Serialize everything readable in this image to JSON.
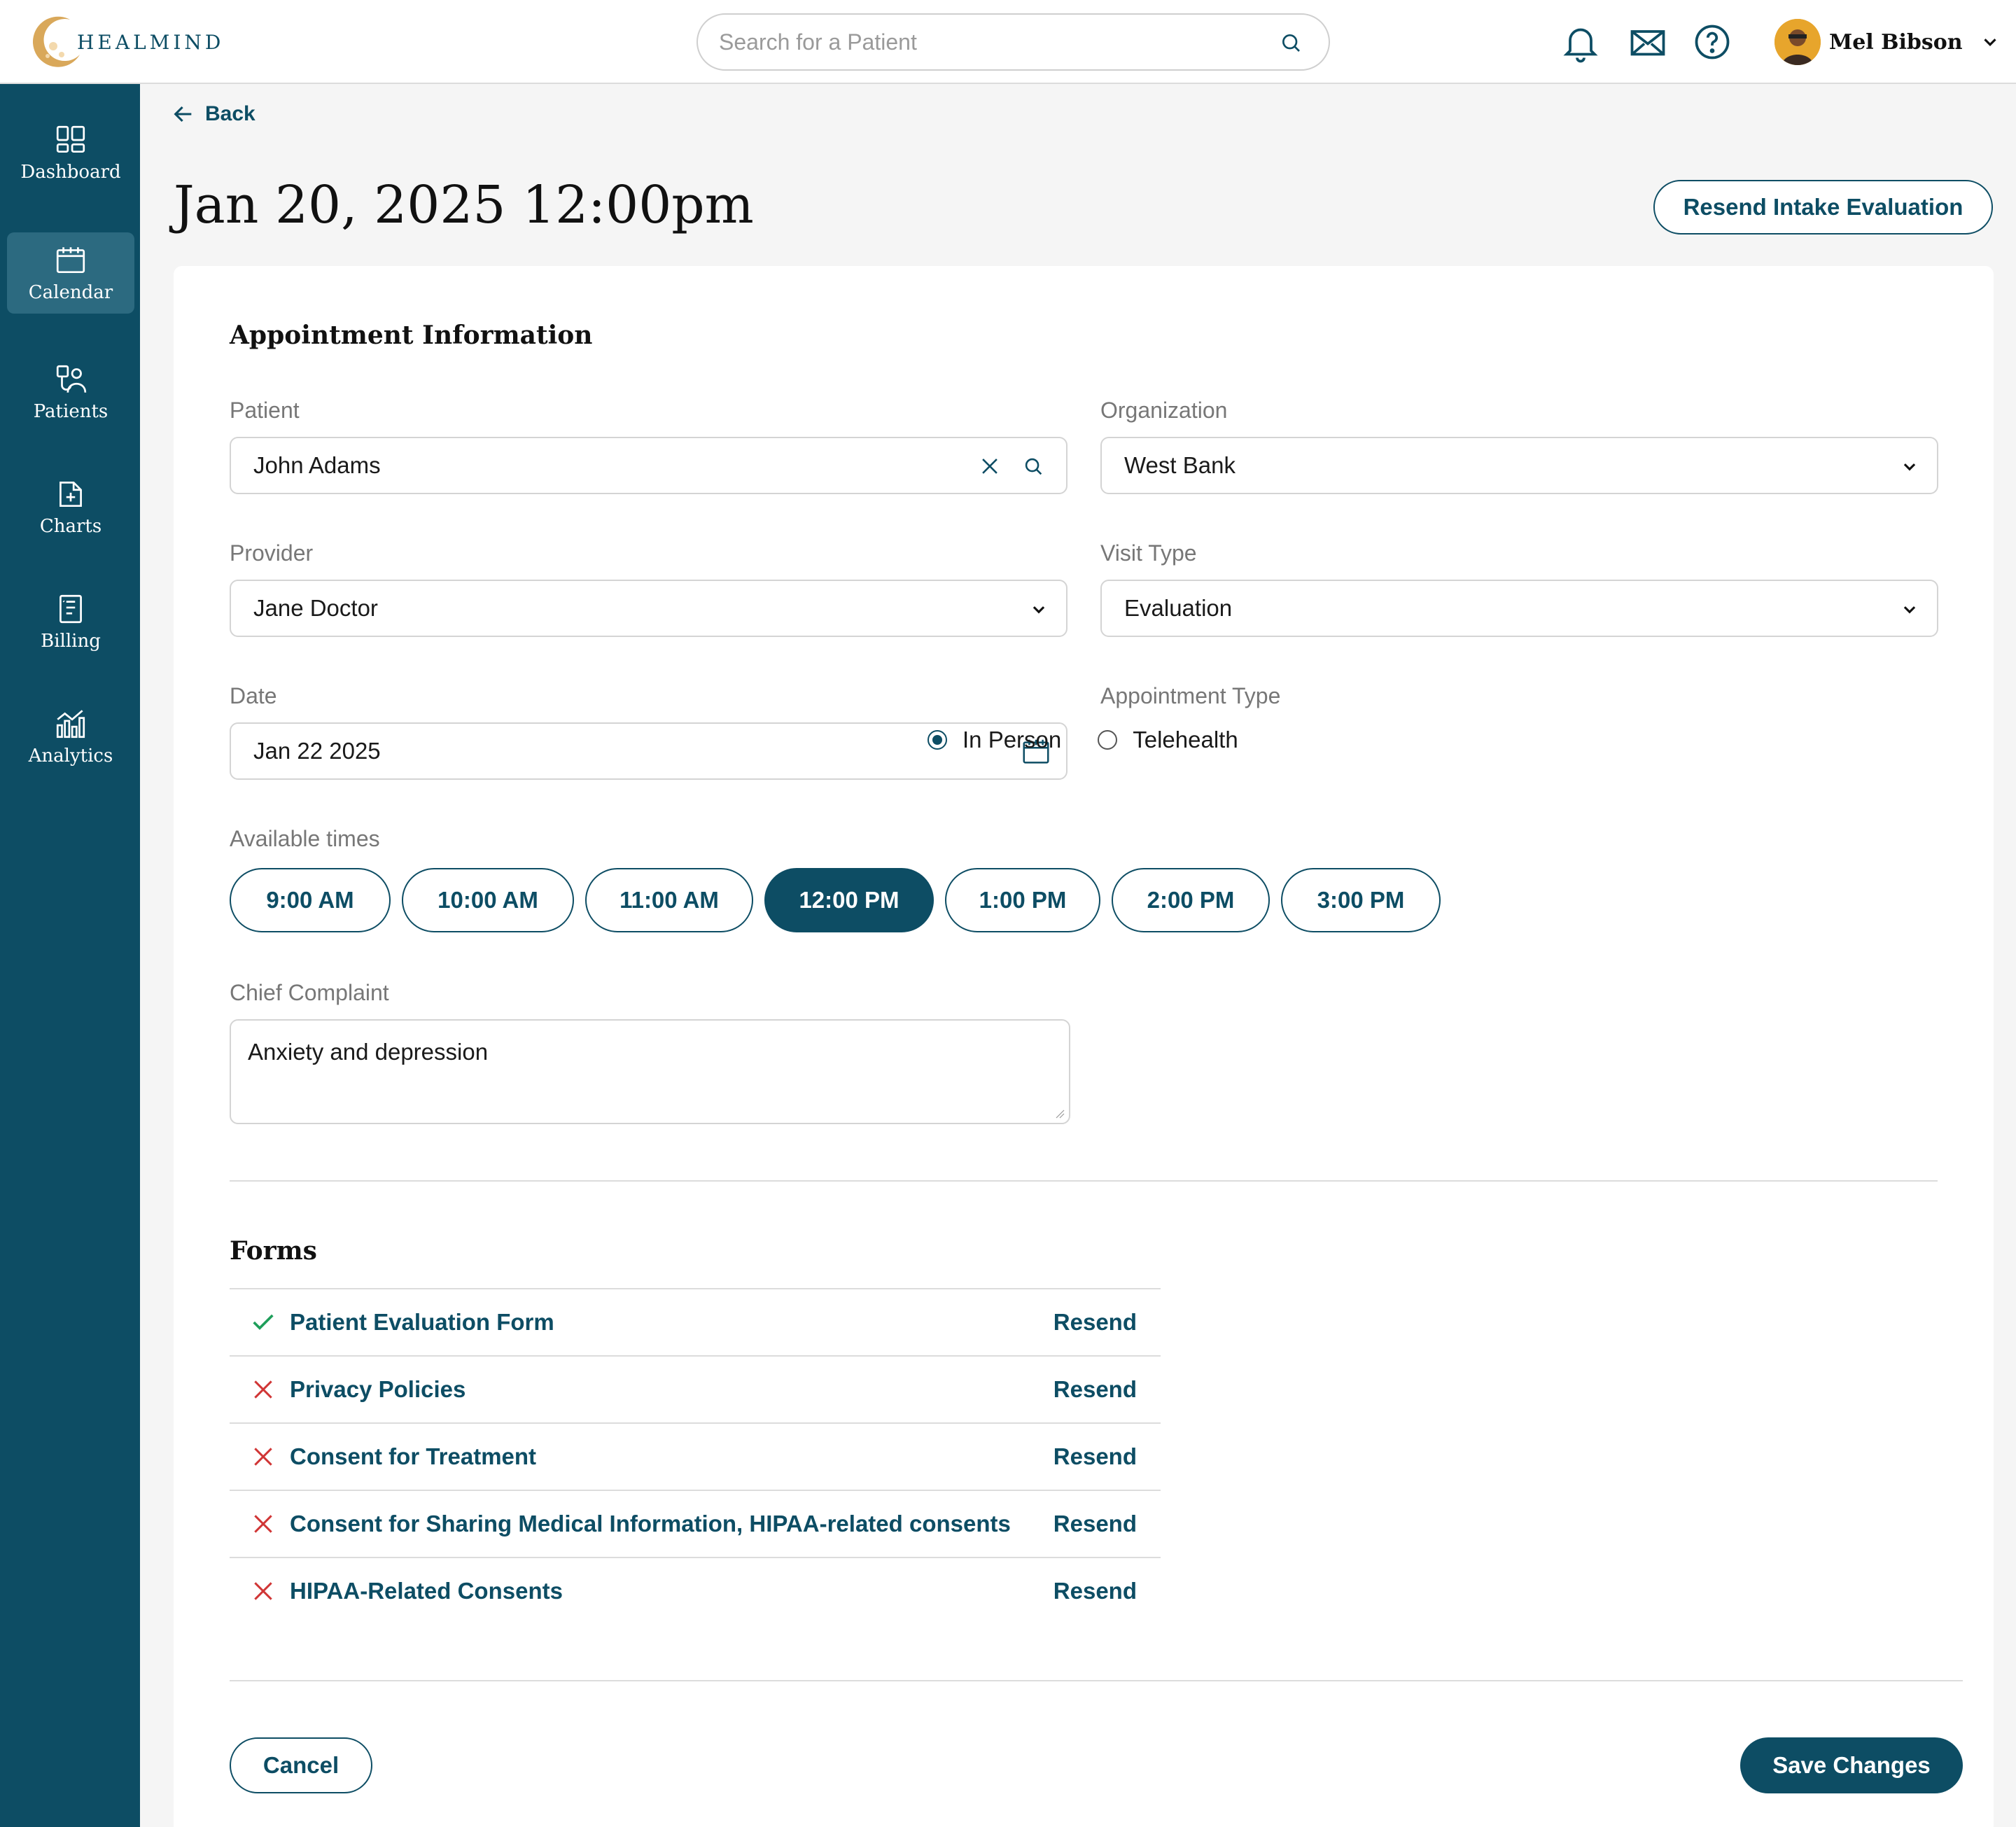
{
  "brand": {
    "name": "HEALMIND",
    "primary_color": "#0d4d64",
    "accent_color": "#c89a4b"
  },
  "header": {
    "search_placeholder": "Search for a Patient",
    "icons": [
      "bell-icon",
      "mail-icon",
      "help-icon"
    ],
    "user_name": "Mel Bibson"
  },
  "sidebar": {
    "items": [
      {
        "label": "Dashboard",
        "icon": "dashboard-icon",
        "active": false
      },
      {
        "label": "Calendar",
        "icon": "calendar-icon",
        "active": true
      },
      {
        "label": "Patients",
        "icon": "patients-icon",
        "active": false
      },
      {
        "label": "Charts",
        "icon": "charts-icon",
        "active": false
      },
      {
        "label": "Billing",
        "icon": "billing-icon",
        "active": false
      },
      {
        "label": "Analytics",
        "icon": "analytics-icon",
        "active": false
      }
    ]
  },
  "page": {
    "back_label": "Back",
    "title": "Jan 20, 2025 12:00pm",
    "resend_intake_label": "Resend Intake Evaluation"
  },
  "appointment": {
    "section_title": "Appointment Information",
    "patient_label": "Patient",
    "patient_value": "John Adams",
    "organization_label": "Organization",
    "organization_value": "West Bank",
    "provider_label": "Provider",
    "provider_value": "Jane Doctor",
    "visit_type_label": "Visit Type",
    "visit_type_value": "Evaluation",
    "date_label": "Date",
    "date_value": "Jan 22 2025",
    "appointment_type_label": "Appointment Type",
    "appointment_type_options": [
      {
        "label": "In Person",
        "selected": true
      },
      {
        "label": "Telehealth",
        "selected": false
      }
    ],
    "available_times_label": "Available times",
    "times": [
      {
        "label": "9:00 AM",
        "selected": false
      },
      {
        "label": "10:00 AM",
        "selected": false
      },
      {
        "label": "11:00 AM",
        "selected": false
      },
      {
        "label": "12:00 PM",
        "selected": true
      },
      {
        "label": "1:00 PM",
        "selected": false
      },
      {
        "label": "2:00 PM",
        "selected": false
      },
      {
        "label": "3:00 PM",
        "selected": false
      }
    ],
    "chief_complaint_label": "Chief Complaint",
    "chief_complaint_value": "Anxiety and depression"
  },
  "forms": {
    "section_title": "Forms",
    "items": [
      {
        "name": "Patient Evaluation Form",
        "status": "complete",
        "action": "Resend"
      },
      {
        "name": "Privacy Policies",
        "status": "incomplete",
        "action": "Resend"
      },
      {
        "name": "Consent for Treatment",
        "status": "incomplete",
        "action": "Resend"
      },
      {
        "name": "Consent for Sharing Medical Information, HIPAA-related consents",
        "status": "incomplete",
        "action": "Resend"
      },
      {
        "name": "HIPAA-Related Consents",
        "status": "incomplete",
        "action": "Resend"
      }
    ],
    "status_colors": {
      "complete": "#1e9e5a",
      "incomplete": "#d03535"
    }
  },
  "footer": {
    "cancel_label": "Cancel",
    "save_label": "Save Changes"
  }
}
